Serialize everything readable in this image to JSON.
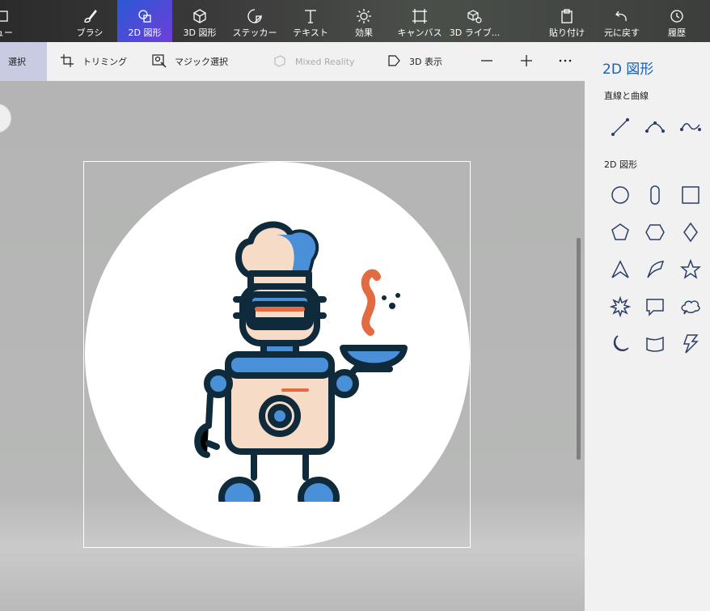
{
  "toolbar": {
    "menu_label": "ュー",
    "brush_label": "ブラシ",
    "shapes2d_label": "2D 図形",
    "shapes3d_label": "3D 図形",
    "sticker_label": "ステッカー",
    "text_label": "テキスト",
    "effects_label": "効果",
    "canvas_label": "キャンバス",
    "library3d_label": "3D ライブ...",
    "paste_label": "貼り付け",
    "undo_label": "元に戻す",
    "history_label": "履歴"
  },
  "subbar": {
    "select_label": "選択",
    "crop_label": "トリミング",
    "magic_select_label": "マジック選択",
    "mixed_reality_label": "Mixed Reality",
    "view3d_label": "3D 表示"
  },
  "panel": {
    "title": "2D 図形",
    "lines_section": "直線と曲線",
    "shapes_section": "2D 図形"
  },
  "colors": {
    "accent": "#1a5fb4",
    "active_tool": "#3b4fd6",
    "robot_outline": "#0f2a3b",
    "robot_blue": "#4a90d9",
    "robot_peach": "#f6dcc6",
    "robot_orange": "#e36b42"
  }
}
